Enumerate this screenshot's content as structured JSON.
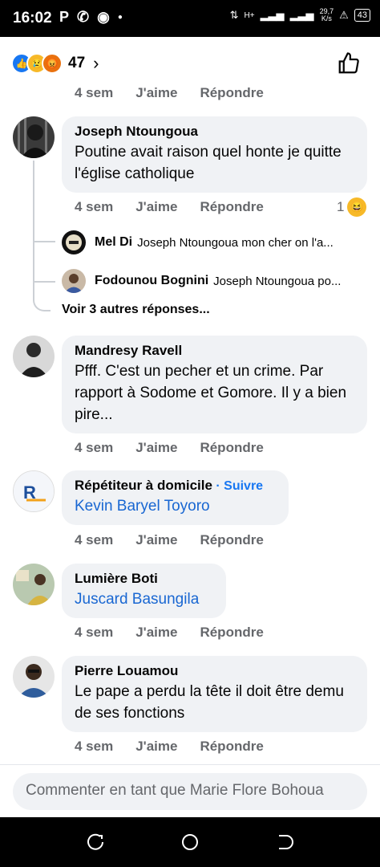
{
  "status": {
    "time": "16:02",
    "speed": "29,7",
    "speed_unit": "K/s",
    "battery": "43",
    "net": "H+"
  },
  "reactions": {
    "count": "47",
    "icons": [
      "like-reaction",
      "sad-reaction",
      "angry-reaction"
    ]
  },
  "actions": {
    "time": "4 sem",
    "like": "J'aime",
    "reply": "Répondre"
  },
  "comments": [
    {
      "name": "Joseph Ntoungoua",
      "text": "Poutine avait raison quel honte je quitte l'église catholique",
      "reaction_count": "1"
    },
    {
      "name": "Mandresy Ravell",
      "text": "Pfff. C'est un pecher et un crime. Par rapport à Sodome et Gomore. Il y a bien pire..."
    },
    {
      "name": "Répétiteur à domicile",
      "follow": "· Suivre",
      "text": "Kevin Baryel Toyoro"
    },
    {
      "name": "Lumière Boti",
      "text": "Juscard Basungila"
    },
    {
      "name": "Pierre Louamou",
      "text": "Le pape a perdu la tête il doit être demu de ses fonctions"
    }
  ],
  "replies": [
    {
      "name": "Mel Di",
      "text": "Joseph Ntoungoua mon cher on l'a..."
    },
    {
      "name": "Fodounou Bognini",
      "text": "Joseph Ntoungoua po..."
    }
  ],
  "more_replies": "Voir 3 autres réponses...",
  "compose": {
    "placeholder": "Commenter en tant que Marie Flore Bohoua"
  },
  "colors": {
    "link": "#1967d2",
    "bubble": "#f0f2f5",
    "meta": "#65676b",
    "accent": "#1877f2"
  }
}
